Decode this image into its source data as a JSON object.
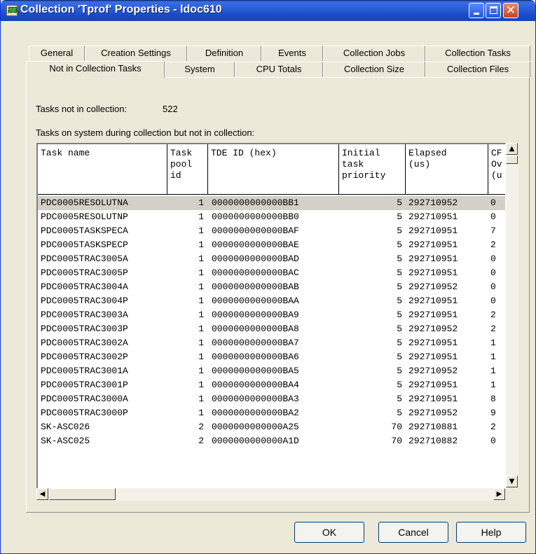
{
  "window": {
    "title": "Collection 'Tprof' Properties - ldoc610",
    "icon": "collection-app-icon",
    "minimize_icon": "minimize-icon",
    "maximize_icon": "maximize-icon",
    "close_icon": "close-icon"
  },
  "tabs": {
    "row1": [
      "General",
      "Creation Settings",
      "Definition",
      "Events",
      "Collection Jobs",
      "Collection Tasks"
    ],
    "row2": [
      "Not in Collection Tasks",
      "System",
      "CPU Totals",
      "Collection Size",
      "Collection Files"
    ],
    "active": "Not in Collection Tasks"
  },
  "panel": {
    "count_label": "Tasks not in collection:",
    "count_value": "522",
    "table_caption": "Tasks on system during collection but not in collection:"
  },
  "table": {
    "columns": [
      "Task name",
      "Task\npool\nid",
      "TDE ID (hex)",
      "Initial\ntask\npriority",
      "Elapsed\n(us)",
      "CF\nOv\n(u"
    ],
    "rows": [
      [
        "PDC0005RESOLUTNA",
        "1",
        "0000000000000BB1",
        "5",
        "292710952",
        "0"
      ],
      [
        "PDC0005RESOLUTNP",
        "1",
        "0000000000000BB0",
        "5",
        "292710951",
        "0"
      ],
      [
        "PDC0005TASKSPECA",
        "1",
        "0000000000000BAF",
        "5",
        "292710951",
        "7"
      ],
      [
        "PDC0005TASKSPECP",
        "1",
        "0000000000000BAE",
        "5",
        "292710951",
        "2"
      ],
      [
        "PDC0005TRAC3005A",
        "1",
        "0000000000000BAD",
        "5",
        "292710951",
        "0"
      ],
      [
        "PDC0005TRAC3005P",
        "1",
        "0000000000000BAC",
        "5",
        "292710951",
        "0"
      ],
      [
        "PDC0005TRAC3004A",
        "1",
        "0000000000000BAB",
        "5",
        "292710952",
        "0"
      ],
      [
        "PDC0005TRAC3004P",
        "1",
        "0000000000000BAA",
        "5",
        "292710951",
        "0"
      ],
      [
        "PDC0005TRAC3003A",
        "1",
        "0000000000000BA9",
        "5",
        "292710951",
        "2"
      ],
      [
        "PDC0005TRAC3003P",
        "1",
        "0000000000000BA8",
        "5",
        "292710952",
        "2"
      ],
      [
        "PDC0005TRAC3002A",
        "1",
        "0000000000000BA7",
        "5",
        "292710951",
        "1"
      ],
      [
        "PDC0005TRAC3002P",
        "1",
        "0000000000000BA6",
        "5",
        "292710951",
        "1"
      ],
      [
        "PDC0005TRAC3001A",
        "1",
        "0000000000000BA5",
        "5",
        "292710952",
        "1"
      ],
      [
        "PDC0005TRAC3001P",
        "1",
        "0000000000000BA4",
        "5",
        "292710951",
        "1"
      ],
      [
        "PDC0005TRAC3000A",
        "1",
        "0000000000000BA3",
        "5",
        "292710951",
        "8"
      ],
      [
        "PDC0005TRAC3000P",
        "1",
        "0000000000000BA2",
        "5",
        "292710952",
        "9"
      ],
      [
        "SK-ASC026",
        "2",
        "0000000000000A25",
        "70",
        "292710881",
        "2"
      ],
      [
        "SK-ASC025",
        "2",
        "0000000000000A1D",
        "70",
        "292710882",
        "0"
      ]
    ],
    "selected_row": 0,
    "scroll_icons": {
      "up": "scroll-up-arrow-icon",
      "down": "scroll-down-arrow-icon",
      "left": "scroll-left-arrow-icon",
      "right": "scroll-right-arrow-icon"
    }
  },
  "buttons": {
    "ok": "OK",
    "cancel": "Cancel",
    "help": "Help"
  }
}
